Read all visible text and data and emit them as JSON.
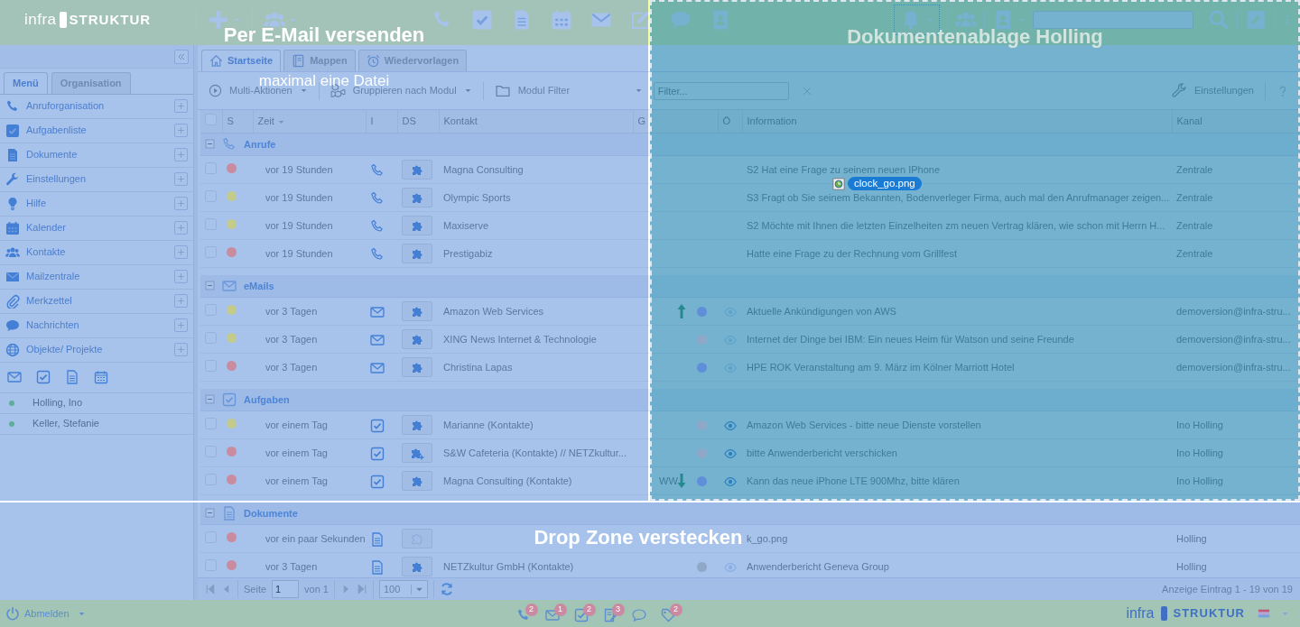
{
  "topbar": {
    "logo": {
      "brand": "infra",
      "suffix": "STRUKTUR"
    },
    "bell_focused": true
  },
  "sidebar": {
    "tabs": [
      {
        "label": "Menü",
        "selected": true
      },
      {
        "label": "Organisation",
        "selected": false
      }
    ],
    "items": [
      {
        "label": "Anruforganisation"
      },
      {
        "label": "Aufgabenliste"
      },
      {
        "label": "Dokumente"
      },
      {
        "label": "Einstellungen"
      },
      {
        "label": "Hilfe"
      },
      {
        "label": "Kalender"
      },
      {
        "label": "Kontakte"
      },
      {
        "label": "Mailzentrale"
      },
      {
        "label": "Merkzettel"
      },
      {
        "label": "Nachrichten"
      },
      {
        "label": "Objekte/ Projekte"
      }
    ],
    "users": [
      {
        "name": "Holling, Ino",
        "color": "#5fae9c"
      },
      {
        "name": "Keller, Stefanie",
        "color": "#5fae9c"
      }
    ]
  },
  "tabs": [
    {
      "label": "Startseite",
      "selected": true
    },
    {
      "label": "Mappen",
      "selected": false
    },
    {
      "label": "Wiedervorlagen",
      "selected": false
    }
  ],
  "toolbar": {
    "multi": "Multi-Aktionen",
    "group": "Gruppieren nach Modul",
    "filter": "Modul Filter",
    "search_placeholder": "Filter...",
    "settings": "Einstellungen"
  },
  "table": {
    "all_checked": false,
    "columns": [
      {
        "label": "S"
      },
      {
        "label": "Zeit",
        "sorted_desc": true
      },
      {
        "label": "I"
      },
      {
        "label": "DS"
      },
      {
        "label": "Kontakt"
      },
      {
        "label": "G"
      },
      {
        "label": "Ö"
      },
      {
        "label": "Information"
      },
      {
        "label": "Kanal"
      }
    ],
    "groups": [
      {
        "kind": "call",
        "label": "Anrufe",
        "expanded": true,
        "rows": [
          {
            "checked": false,
            "color": "#c98c9e",
            "time": "vor 19 Stunden",
            "linked": true,
            "link_add": false,
            "contact": "Magna Consulting",
            "info": "S2 Hat eine Frage zu seinem neuen IPhone",
            "channel": "Zentrale"
          },
          {
            "checked": false,
            "color": "#c2ca8c",
            "time": "vor 19 Stunden",
            "linked": true,
            "link_add": false,
            "contact": "Olympic Sports",
            "info": "S3 Fragt ob Sie seinem Bekannten, Bodenverleger Firma, auch mal den Anrufmanager zeigen...",
            "channel": "Zentrale"
          },
          {
            "checked": false,
            "color": "#c2ca8c",
            "time": "vor 19 Stunden",
            "linked": true,
            "link_add": false,
            "contact": "Maxiserve",
            "info": "S2 Möchte mit Ihnen die letzten Einzelheiten zm neuen Vertrag klären, wie schon mit Herrn H...",
            "channel": "Zentrale"
          },
          {
            "checked": false,
            "color": "#c98c9e",
            "time": "vor 19 Stunden",
            "linked": true,
            "link_add": false,
            "contact": "Prestigabiz",
            "info": "Hatte eine Frage zu der Rechnung vom Grillfest",
            "channel": "Zentrale"
          }
        ]
      },
      {
        "kind": "email",
        "label": "eMails",
        "expanded": true,
        "rows": [
          {
            "checked": false,
            "color": "#c2ca8c",
            "time": "vor 3 Tagen",
            "linked": true,
            "link_add": false,
            "contact": "Amazon Web Services",
            "priority_up": true,
            "unread": true,
            "seen": false,
            "info": "Aktuelle Ankündigungen von AWS",
            "channel": "demoversion@infra-stru..."
          },
          {
            "checked": false,
            "color": "#c2ca8c",
            "time": "vor 3 Tagen",
            "linked": true,
            "link_add": false,
            "contact": "XING News Internet & Technologie",
            "unread": false,
            "seen": false,
            "info": "Internet der Dinge bei IBM: Ein neues Heim für Watson und seine Freunde",
            "channel": "demoversion@infra-stru..."
          },
          {
            "checked": false,
            "color": "#c98c9e",
            "time": "vor 3 Tagen",
            "linked": true,
            "link_add": false,
            "contact": "Christina Lapas",
            "unread": true,
            "seen": false,
            "info": "HPE ROK Veranstaltung am 9. März im Kölner Marriott Hotel",
            "channel": "demoversion@infra-stru..."
          }
        ]
      },
      {
        "kind": "task",
        "label": "Aufgaben",
        "expanded": true,
        "rows": [
          {
            "checked": false,
            "color": "#c2ca8c",
            "time": "vor einem Tag",
            "linked": true,
            "link_add": false,
            "contact": "Marianne (Kontakte)",
            "unread": false,
            "seen": true,
            "info": "Amazon Web Services - bitte neue Dienste vorstellen",
            "channel": "Ino Holling"
          },
          {
            "checked": false,
            "color": "#c98c9e",
            "time": "vor einem Tag",
            "linked": true,
            "link_add": true,
            "contact": "S&W Cafeteria (Kontakte) // NETZkultur...",
            "unread": false,
            "seen": true,
            "info": "bitte Anwenderbericht verschicken",
            "channel": "Ino Holling"
          },
          {
            "checked": false,
            "color": "#c98c9e",
            "time": "vor einem Tag",
            "linked": true,
            "link_add": false,
            "contact": "Magna Consulting (Kontakte)",
            "g": "WW",
            "priority_down": true,
            "unread": true,
            "seen": true,
            "info": "Kann das neue iPhone LTE 900Mhz, bitte klären",
            "channel": "Ino Holling"
          }
        ]
      },
      {
        "kind": "document",
        "label": "Dokumente",
        "expanded": true,
        "rows": [
          {
            "checked": false,
            "color": "#c98c9e",
            "time": "vor ein paar Sekunden",
            "linked": false,
            "info": "k_go.png",
            "channel": "Holling"
          },
          {
            "checked": false,
            "color": "#c98c9e",
            "time": "vor 3 Tagen",
            "linked": true,
            "link_add": false,
            "contact": "NETZkultur GmbH (Kontakte)",
            "unread": false,
            "seen": false,
            "info": "Anwenderbericht Geneva Group",
            "channel": "Holling"
          }
        ]
      }
    ]
  },
  "pager": {
    "page_label": "Seite",
    "page": "1",
    "of": "von 1",
    "page_size": "100",
    "summary": "Anzeige Eintrag 1 - 19 von 19"
  },
  "footer": {
    "logout": "Abmelden",
    "counters": [
      {
        "badge": true,
        "count": "2"
      },
      {
        "badge": true,
        "count": "1"
      },
      {
        "badge": true,
        "count": "2"
      },
      {
        "badge": true,
        "count": "3"
      },
      {
        "badge": false
      },
      {
        "badge": true,
        "count": "2"
      }
    ],
    "logo": {
      "brand": "infra",
      "suffix": "STRUKTUR"
    }
  },
  "drop_zones": [
    {
      "title": "Per E-Mail versenden",
      "subtitle": "maximal eine Datei",
      "active": false
    },
    {
      "title": "Dokumentenablage Holling",
      "active": true
    },
    {
      "title": "Drop Zone verstecken",
      "active": false
    }
  ],
  "drag": {
    "file": "clock_go.png"
  }
}
